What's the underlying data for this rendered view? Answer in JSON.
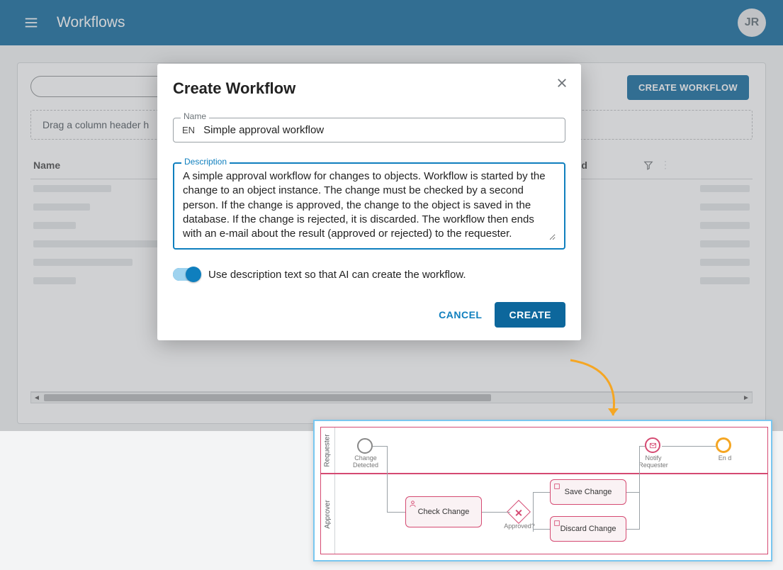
{
  "header": {
    "page_title": "Workflows",
    "avatar_initials": "JR"
  },
  "toolbar": {
    "create_workflow_button": "CREATE WORKFLOW"
  },
  "grid": {
    "drag_hint": "Drag a column header h",
    "columns": {
      "name": "Name",
      "modified": "odified"
    }
  },
  "dialog": {
    "title": "Create Workflow",
    "name_label": "Name",
    "name_lang": "EN",
    "name_value": "Simple approval workflow",
    "description_label": "Description",
    "description_value": "A simple approval workflow for changes to objects. Workflow is started by the change to an object instance. The change must be checked by a second person. If the change is approved, the change to the object is saved in the database. If the change is rejected, it is discarded. The workflow then ends with an e-mail about the result (approved or rejected) to the requester.",
    "ai_toggle_label": "Use description text so that AI can create the workflow.",
    "cancel": "CANCEL",
    "create": "CREATE"
  },
  "preview": {
    "lanes": {
      "requester": "Requester",
      "approver": "Approver"
    },
    "nodes": {
      "start": "Change Detected",
      "check": "Check Change",
      "gateway": "Approved?",
      "save": "Save Change",
      "discard": "Discard Change",
      "notify": "Notify Requester",
      "end": "En d"
    }
  }
}
